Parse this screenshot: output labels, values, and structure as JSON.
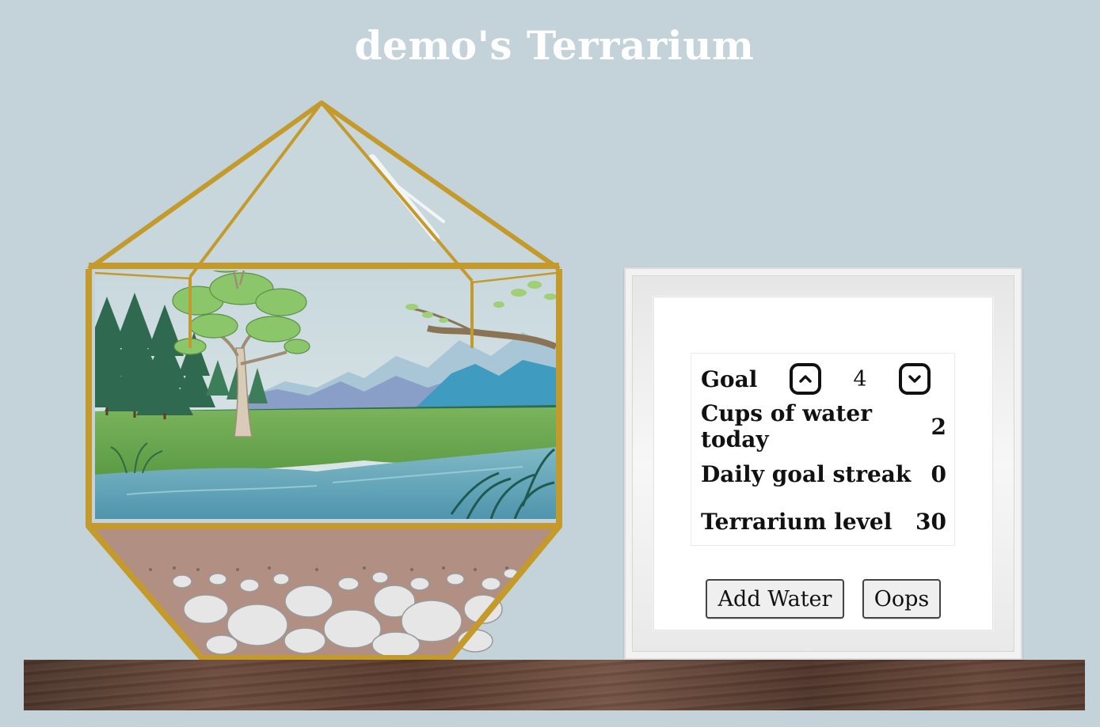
{
  "header": {
    "title": "demo's Terrarium"
  },
  "stats": {
    "goal_label": "Goal",
    "goal_value": "4",
    "cups_label": "Cups of water today",
    "cups_value": "2",
    "streak_label": "Daily goal streak",
    "streak_value": "0",
    "level_label": "Terrarium level",
    "level_value": "30"
  },
  "actions": {
    "add_water_label": "Add Water",
    "oops_label": "Oops"
  },
  "icons": {
    "goal_up": "chevron-up-icon",
    "goal_down": "chevron-down-icon"
  },
  "colors": {
    "background": "#c3d3d9",
    "terrarium_frame": "#c49a2c",
    "shelf": "#5b3e31"
  }
}
